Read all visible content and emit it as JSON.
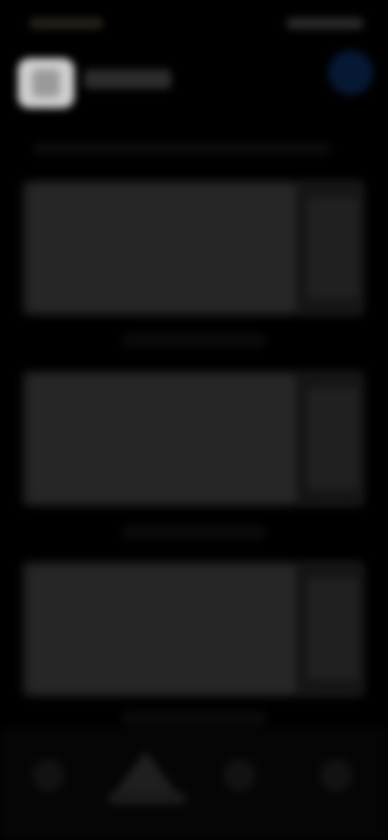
{
  "screen": {
    "background": "#000000",
    "note_visible_text": ""
  },
  "status_bar": {
    "left_text": "",
    "right_text": ""
  },
  "header": {
    "username": "",
    "action_icon": "circle-icon",
    "accent_color": "#061833"
  },
  "content": {
    "subtitle": "",
    "cards": [
      {
        "caption": ""
      },
      {
        "caption": ""
      },
      {
        "caption": ""
      }
    ]
  },
  "bottom_nav": {
    "items": [
      {
        "icon": "nav-icon-1"
      },
      {
        "icon": "home-icon"
      },
      {
        "icon": "nav-icon-3"
      },
      {
        "icon": "nav-icon-4"
      }
    ]
  }
}
